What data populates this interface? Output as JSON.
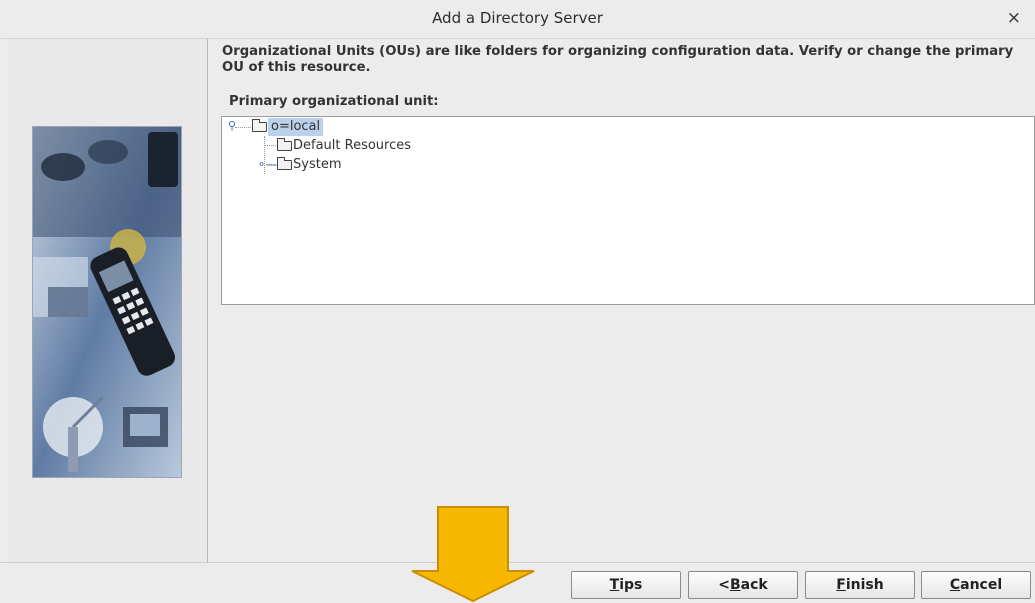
{
  "window": {
    "title": "Add a Directory Server",
    "close_glyph": "×"
  },
  "description": "Organizational Units (OUs) are like folders for organizing configuration data.  Verify or change the primary OU of this resource.",
  "tree": {
    "label": "Primary organizational unit:",
    "nodes": [
      {
        "label": "o=local",
        "selected": true,
        "expanded": true
      },
      {
        "label": "Default Resources",
        "selected": false
      },
      {
        "label": "System",
        "selected": false,
        "expanded": false
      }
    ]
  },
  "buttons": {
    "tips": {
      "mnemonic": "T",
      "rest": "ips"
    },
    "back": {
      "prefix": "<",
      "mnemonic": "B",
      "rest": "ack"
    },
    "finish": {
      "mnemonic": "F",
      "rest": "inish"
    },
    "cancel": {
      "mnemonic": "C",
      "rest": "ancel"
    }
  },
  "colors": {
    "annotation_arrow": "#f5b700",
    "selection": "#b9d1ea",
    "tree_handle": "#3a6fb5"
  },
  "icons": [
    "close-icon",
    "folder-icon",
    "tree-expand-handle-icon",
    "down-arrow-annotation"
  ]
}
